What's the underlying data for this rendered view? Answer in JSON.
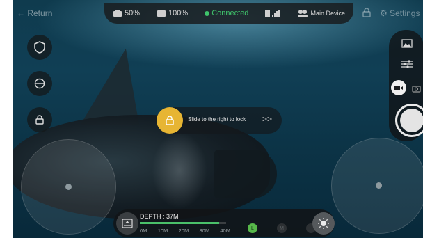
{
  "topbar": {
    "back_label": "Return",
    "battery_remote": "50%",
    "battery_drone": "100%",
    "connection_status": "Connected",
    "device_label": "Main Device",
    "settings_label": "Settings"
  },
  "lock_slider": {
    "text": "Slide to the right to lock",
    "arrow": ">>"
  },
  "depth": {
    "label": "DEPTH : 37M",
    "scale": [
      "0M",
      "10M",
      "20M",
      "30M",
      "40M"
    ],
    "progress_fraction": 0.92
  },
  "speed_modes": [
    "L",
    "M",
    "H"
  ],
  "colors": {
    "accent_yellow": "#e7b533",
    "connected_green": "#3fc46b",
    "speed_active": "#57b84a"
  },
  "icons": {
    "left_toolbar": [
      "shield-icon",
      "gimbal-icon",
      "lock-icon"
    ],
    "right_panel": [
      "gallery-icon",
      "adjust-icon",
      "video-icon",
      "camera-icon"
    ]
  }
}
